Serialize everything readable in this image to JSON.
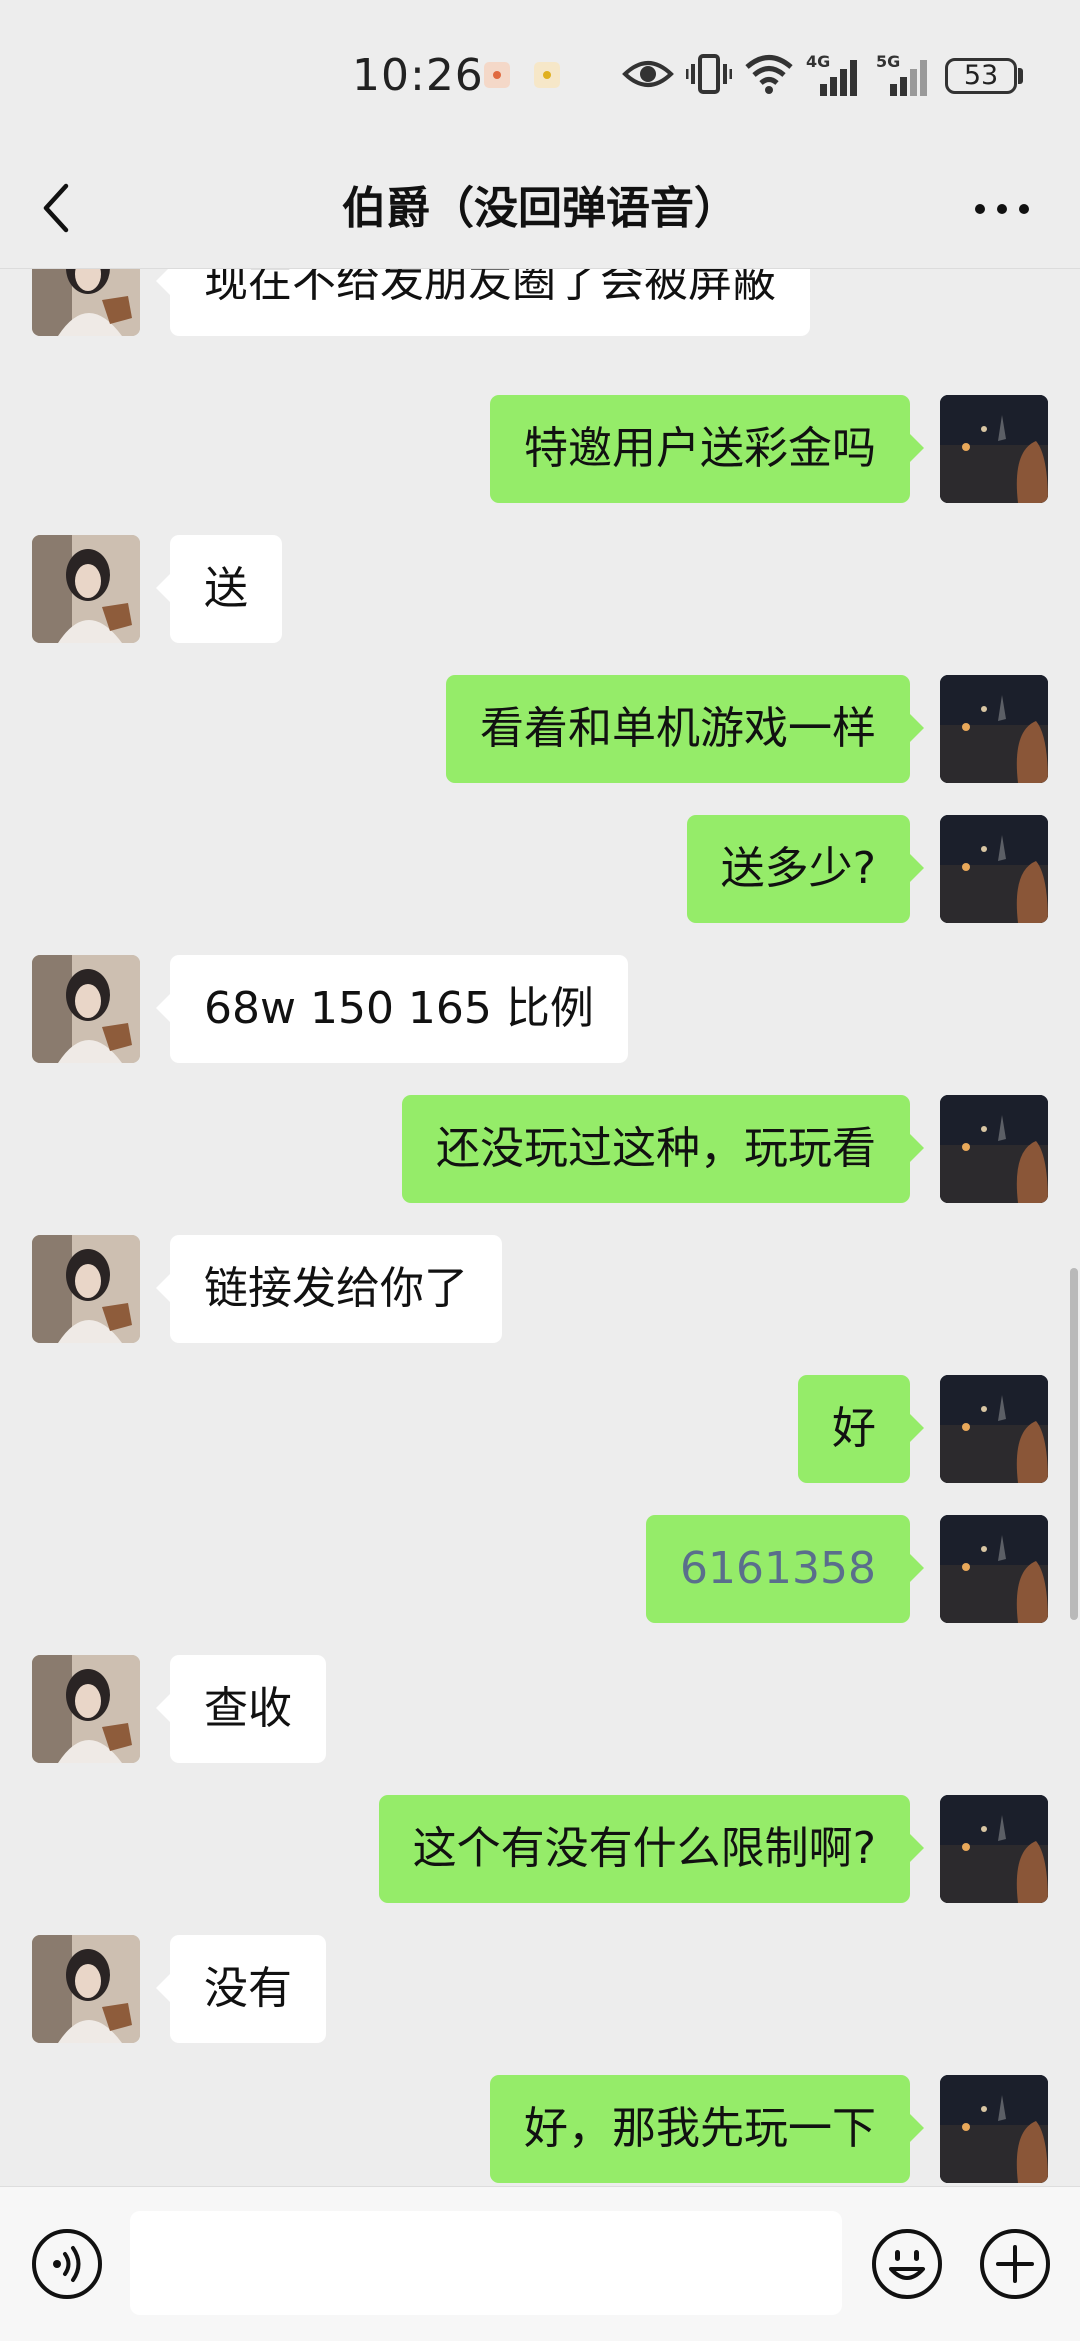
{
  "status_bar": {
    "time": "10:26",
    "battery": "53",
    "signal_1": "4G",
    "signal_2": "5G",
    "icons": [
      "notification-icon",
      "notification-icon",
      "eye-icon",
      "vibrate-icon",
      "wifi-icon",
      "signal-4g-icon",
      "signal-5g-icon",
      "battery-icon"
    ]
  },
  "header": {
    "title": "伯爵（没回弹语音）",
    "back_icon": "chevron-left-icon",
    "more_icon": "more-dots-icon"
  },
  "messages": [
    {
      "side": "left",
      "text": "现在不给发朋友圈了会被屏蔽"
    },
    {
      "side": "right",
      "text": "特邀用户送彩金吗"
    },
    {
      "side": "left",
      "text": "送"
    },
    {
      "side": "right",
      "text": "看着和单机游戏一样"
    },
    {
      "side": "right",
      "text": "送多少?"
    },
    {
      "side": "left",
      "text": "68w 150 165 比例"
    },
    {
      "side": "right",
      "text": "还没玩过这种，玩玩看"
    },
    {
      "side": "left",
      "text": "链接发给你了"
    },
    {
      "side": "right",
      "text": "好"
    },
    {
      "side": "right",
      "text": "6161358"
    },
    {
      "side": "left",
      "text": "查收"
    },
    {
      "side": "right",
      "text": "这个有没有什么限制啊?"
    },
    {
      "side": "left",
      "text": "没有"
    },
    {
      "side": "right",
      "text": "好，那我先玩一下"
    }
  ],
  "input_bar": {
    "value": "",
    "icons": [
      "voice-icon",
      "emoji-icon",
      "plus-icon"
    ]
  },
  "colors": {
    "background": "#ededed",
    "bubble_self": "#95ec69",
    "bubble_other": "#ffffff",
    "number_link": "#5a6e8c"
  }
}
